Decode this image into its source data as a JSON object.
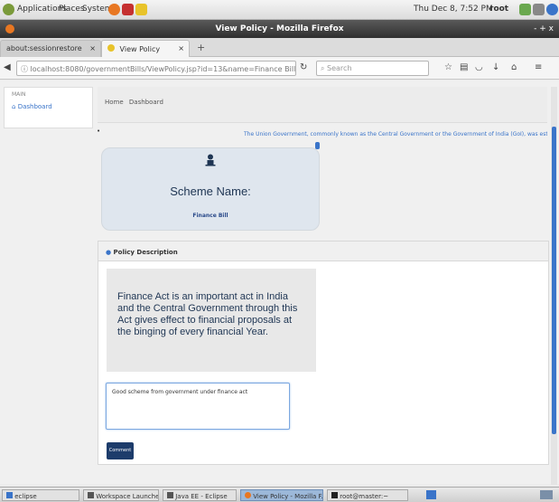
{
  "panel": {
    "menus": [
      "Applications",
      "Places",
      "System"
    ],
    "clock": "Thu Dec 8, 7:52 PM",
    "user": "root"
  },
  "window": {
    "title": "View Policy - Mozilla Firefox",
    "controls": "- + x"
  },
  "tabs": [
    {
      "label": "about:sessionrestore"
    },
    {
      "label": "View Policy"
    }
  ],
  "nav": {
    "url": "localhost:8080/governmentBills/ViewPolicy.jsp?id=13&name=Finance Bill",
    "search_placeholder": "Search"
  },
  "sidebar": {
    "heading": "MAIN",
    "dashboard": "Dashboard"
  },
  "breadcrumb": {
    "home": "Home",
    "current": "Dashboard"
  },
  "ticker": "The Union Government, commonly known as the Central Government or the Government of India (GoI), was establ",
  "scheme": {
    "title": "Scheme Name:",
    "value": "Finance Bill"
  },
  "policy": {
    "header": "Policy Description",
    "description": "Finance Act is an important act in India and the Central Government through this Act gives effect to financial proposals at the binging of every financial Year."
  },
  "comment": {
    "text": "Good scheme from government under finance act",
    "button_label": "Comment"
  },
  "taskbar": {
    "items": [
      "eclipse",
      "Workspace Launcher",
      "Java EE - Eclipse",
      "View Policy - Mozilla F...",
      "root@master:~"
    ]
  },
  "colors": {
    "accent": "#3a74c9",
    "button": "#1d3c6b",
    "scheme_card": "#dfe6ee"
  }
}
